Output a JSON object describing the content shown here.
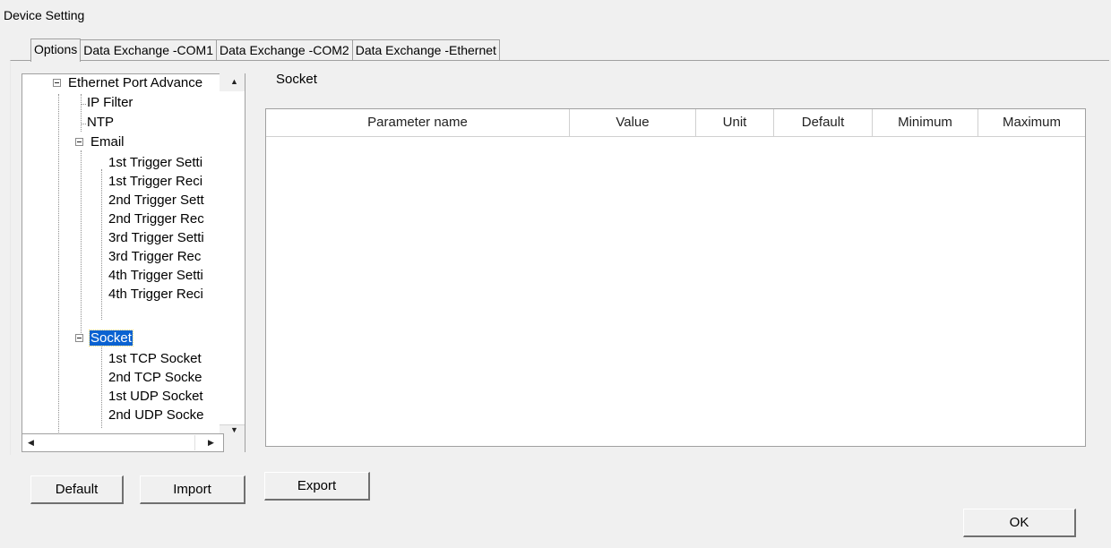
{
  "window": {
    "title": "Device Setting"
  },
  "tabs": [
    {
      "label": "Options",
      "active": true
    },
    {
      "label": "Data Exchange -COM1",
      "active": false
    },
    {
      "label": "Data Exchange -COM2",
      "active": false
    },
    {
      "label": "Data Exchange -Ethernet",
      "active": false
    }
  ],
  "tree": {
    "items": [
      {
        "label": "Ethernet Port Advance",
        "expanded": true
      },
      {
        "label": "IP Filter"
      },
      {
        "label": "NTP"
      },
      {
        "label": "Email",
        "expanded": true
      },
      {
        "label": "1st Trigger Setti"
      },
      {
        "label": "1st Trigger Reci"
      },
      {
        "label": "2nd Trigger Sett"
      },
      {
        "label": "2nd Trigger Rec"
      },
      {
        "label": "3rd Trigger Setti"
      },
      {
        "label": "3rd Trigger Rec"
      },
      {
        "label": "4th Trigger Setti"
      },
      {
        "label": "4th Trigger Reci"
      },
      {
        "label": "Socket",
        "expanded": true,
        "selected": true
      },
      {
        "label": "1st TCP Socket"
      },
      {
        "label": "2nd TCP Socke"
      },
      {
        "label": "1st UDP Socket"
      },
      {
        "label": "2nd UDP Socke"
      }
    ]
  },
  "main": {
    "section_title": "Socket",
    "columns": [
      "Parameter name",
      "Value",
      "Unit",
      "Default",
      "Minimum",
      "Maximum"
    ]
  },
  "buttons": {
    "default_label": "Default",
    "import_label": "Import",
    "export_label": "Export",
    "ok_label": "OK"
  },
  "colors": {
    "selection": "#0a62d1",
    "background": "#f0f0f0"
  }
}
